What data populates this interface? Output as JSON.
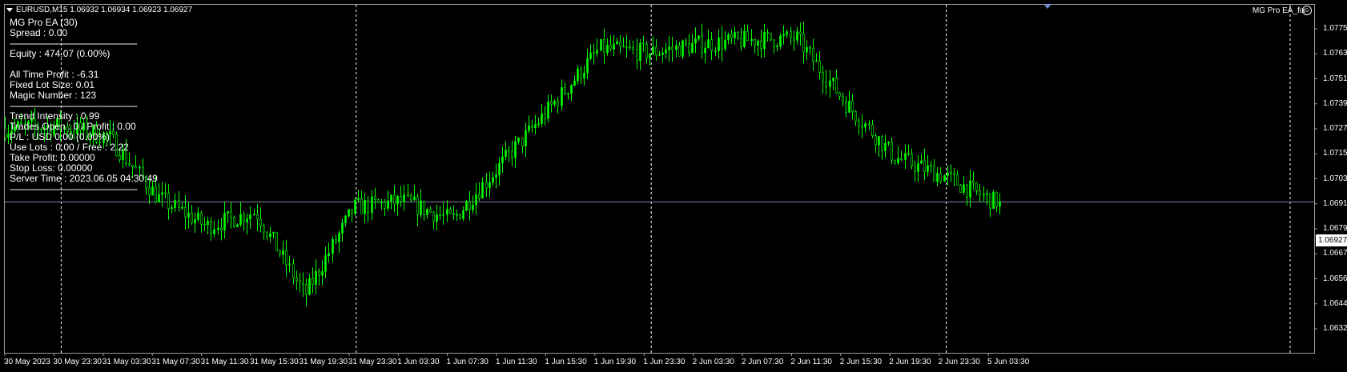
{
  "header": {
    "symbol_line": "EURUSD,M15  1.06932 1.06934 1.06923 1.06927",
    "ea_name": "MG Pro EA_fix"
  },
  "info_panel": {
    "ea_title": "MG Pro EA (30)",
    "spread": "Spread : 0.00",
    "separator": "-----------------------------------------------------",
    "equity": "Equity : 474.07 (0.00%)",
    "all_time_profit": "All Time Profit : -6.31",
    "fixed_lot_size": "Fixed Lot Size: 0.01",
    "magic_number": "Magic Number : 123",
    "trend_intensity": "Trend Intensity : 0.99",
    "trades_open": "Trades Open : 0 / Profit : 0.00",
    "pl": "P/L : USD 0.00 (0.00%)",
    "use_lots": "Use Lots : 0.00 / Free : 2.22",
    "take_profit": "Take Profit: 0.00000",
    "stop_loss": "Stop Loss: 0.00000",
    "server_time": "Server Time : 2023.06.05 04:30:49"
  },
  "current_price": "1.06927",
  "colors": {
    "candle": "#00ff00",
    "background": "#000000",
    "grid": "#ffffff",
    "bid_line": "#7a8ca8"
  },
  "chart_data": {
    "type": "candlestick",
    "symbol": "EURUSD",
    "timeframe": "M15",
    "last_ohlc": {
      "open": 1.06932,
      "high": 1.06934,
      "low": 1.06923,
      "close": 1.06927
    },
    "ylim": [
      1.0632,
      1.0787
    ],
    "y_ticks": [
      "1.07755",
      "1.07635",
      "1.07515",
      "1.07395",
      "1.07275",
      "1.07155",
      "1.07035",
      "1.06915",
      "1.06795",
      "1.06675",
      "1.06560",
      "1.06440",
      "1.06320"
    ],
    "x_ticks": [
      "30 May 2023",
      "30 May 23:30",
      "31 May 03:30",
      "31 May 07:30",
      "31 May 11:30",
      "31 May 15:30",
      "31 May 19:30",
      "31 May 23:30",
      "1 Jun 03:30",
      "1 Jun 07:30",
      "1 Jun 11:30",
      "1 Jun 15:30",
      "1 Jun 19:30",
      "1 Jun 23:30",
      "2 Jun 03:30",
      "2 Jun 07:30",
      "2 Jun 11:30",
      "2 Jun 15:30",
      "2 Jun 19:30",
      "2 Jun 23:30",
      "5 Jun 03:30"
    ],
    "period_separators": [
      "30 May 23:30",
      "31 May 23:30",
      "1 Jun 23:30",
      "2 Jun 23:30"
    ],
    "price_path": [
      [
        "30 May 2023",
        1.0728
      ],
      [
        "30 May 23:30",
        1.0729
      ],
      [
        "31 May 03:30",
        1.0724
      ],
      [
        "31 May 07:30",
        1.0695
      ],
      [
        "31 May 11:30",
        1.0681
      ],
      [
        "31 May 15:30",
        1.0688
      ],
      [
        "31 May 19:30",
        1.0648
      ],
      [
        "31 May 23:30",
        1.069
      ],
      [
        "1 Jun 03:30",
        1.0693
      ],
      [
        "1 Jun 07:30",
        1.0684
      ],
      [
        "1 Jun 11:30",
        1.0711
      ],
      [
        "1 Jun 15:30",
        1.0738
      ],
      [
        "1 Jun 19:30",
        1.0766
      ],
      [
        "1 Jun 23:30",
        1.0764
      ],
      [
        "2 Jun 03:30",
        1.0768
      ],
      [
        "2 Jun 07:30",
        1.077
      ],
      [
        "2 Jun 11:30",
        1.0771
      ],
      [
        "2 Jun 15:30",
        1.074
      ],
      [
        "2 Jun 19:30",
        1.0714
      ],
      [
        "2 Jun 23:30",
        1.0705
      ],
      [
        "5 Jun 03:30",
        1.0693
      ]
    ],
    "grid": false,
    "legend": "none"
  }
}
